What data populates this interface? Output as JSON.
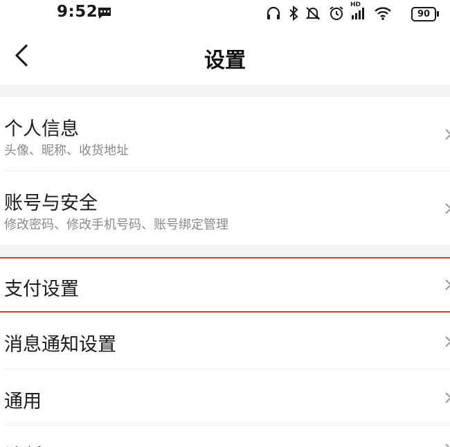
{
  "status_bar": {
    "time": "9:52",
    "battery": "90",
    "hd_label": "HD",
    "icons": [
      "message-icon",
      "headphones-icon",
      "bluetooth-icon",
      "mute-icon",
      "alarm-icon",
      "signal-icon",
      "wifi-icon",
      "battery-icon"
    ]
  },
  "header": {
    "title": "设置",
    "back_icon": "chevron-left-icon"
  },
  "settings": {
    "personal_info": {
      "title": "个人信息",
      "subtitle": "头像、昵称、收货地址"
    },
    "account_security": {
      "title": "账号与安全",
      "subtitle": "修改密码、修改手机号码、账号绑定管理"
    },
    "payment": {
      "title": "支付设置"
    },
    "notifications": {
      "title": "消息通知设置"
    },
    "general": {
      "title": "通用"
    },
    "diagnostics": {
      "title": "诊断工具"
    }
  },
  "colors": {
    "highlight_border": "#d83a34",
    "section_gap": "#f3f3f3",
    "subtitle": "#8a8a8a"
  }
}
